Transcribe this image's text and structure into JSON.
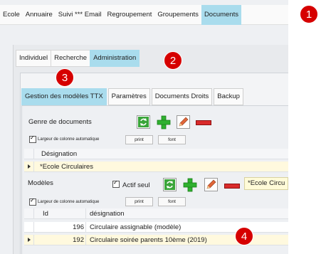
{
  "topnav": {
    "tabs": [
      "Ecole",
      "Annuaire",
      "Suivi *** Email",
      "Regroupement",
      "Groupements",
      "Documents"
    ],
    "active": "Documents"
  },
  "subnav": {
    "tabs": [
      "Individuel",
      "Recherche",
      "Administration"
    ],
    "active": "Administration"
  },
  "gestion_tabs": {
    "tabs": [
      "Gestion des modèles TTX",
      "Paramètres",
      "Documents Droits",
      "Backup"
    ],
    "active": "Gestion des modèles TTX"
  },
  "genre": {
    "title": "Genre de documents",
    "auto_width_label": "Largeur de colonne automatique",
    "print_label": "print",
    "font_label": "font",
    "column_header": "Désignation",
    "rows": [
      {
        "designation": "*Ecole Circulaires"
      }
    ]
  },
  "modeles": {
    "title": "Modèles",
    "actif_label": "Actif seul",
    "filter_value": "*Ecole Circu",
    "auto_width_label": "Largeur de colonne automatique",
    "print_label": "print",
    "font_label": "font",
    "columns": [
      "Id",
      "désignation"
    ],
    "rows": [
      {
        "id": "196",
        "designation": "Circulaire assignable (modèle)"
      },
      {
        "id": "192",
        "designation": "Circulaire soirée parents 10ème (2019)"
      }
    ]
  },
  "badges": [
    "1",
    "2",
    "3",
    "4"
  ],
  "colors": {
    "active_tab": "#a9dced",
    "badge": "#d60000",
    "selected_row": "#fff9de",
    "add_green": "#2fb02f",
    "delete_red": "#d92b2b"
  },
  "icons": {
    "refresh": "refresh-icon",
    "add": "add-icon",
    "edit": "pencil-icon",
    "delete": "delete-icon"
  }
}
